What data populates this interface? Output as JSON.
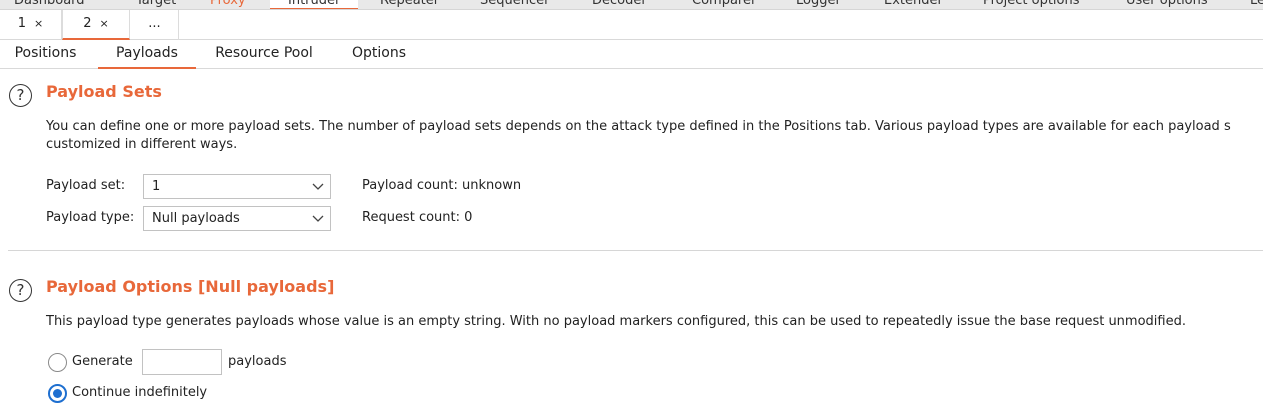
{
  "tool_tabs": [
    {
      "label": "Dashboard"
    },
    {
      "label": "Target"
    },
    {
      "label": "Proxy"
    },
    {
      "label": "Intruder"
    },
    {
      "label": "Repeater"
    },
    {
      "label": "Sequencer"
    },
    {
      "label": "Decoder"
    },
    {
      "label": "Comparer"
    },
    {
      "label": "Logger"
    },
    {
      "label": "Extender"
    },
    {
      "label": "Project options"
    },
    {
      "label": "User options"
    },
    {
      "label": "Le"
    }
  ],
  "instance_tabs": [
    {
      "label": "1",
      "close": "×"
    },
    {
      "label": "2",
      "close": "×"
    },
    {
      "label": "..."
    }
  ],
  "sub_tabs": [
    {
      "label": "Positions"
    },
    {
      "label": "Payloads"
    },
    {
      "label": "Resource Pool"
    },
    {
      "label": "Options"
    }
  ],
  "payload_sets": {
    "help_icon": "?",
    "title": "Payload Sets",
    "description_line1": "You can define one or more payload sets. The number of payload sets depends on the attack type defined in the Positions tab. Various payload types are available for each payload s",
    "description_line2": "customized in different ways.",
    "payload_set_label": "Payload set:",
    "payload_set_value": "1",
    "payload_type_label": "Payload type:",
    "payload_type_value": "Null payloads",
    "payload_count": "Payload count: unknown",
    "request_count": "Request count: 0"
  },
  "payload_options": {
    "help_icon": "?",
    "title": "Payload Options [Null payloads]",
    "description": "This payload type generates payloads whose value is an empty string. With no payload markers configured, this can be used to repeatedly issue the base request unmodified.",
    "generate_label": "Generate",
    "generate_value": "",
    "payloads_suffix": "payloads",
    "continue_label": "Continue indefinitely",
    "selected_option": "Continue indefinitely"
  },
  "colors": {
    "accent": "#e8683a",
    "radio_selected": "#1e6fd0"
  }
}
